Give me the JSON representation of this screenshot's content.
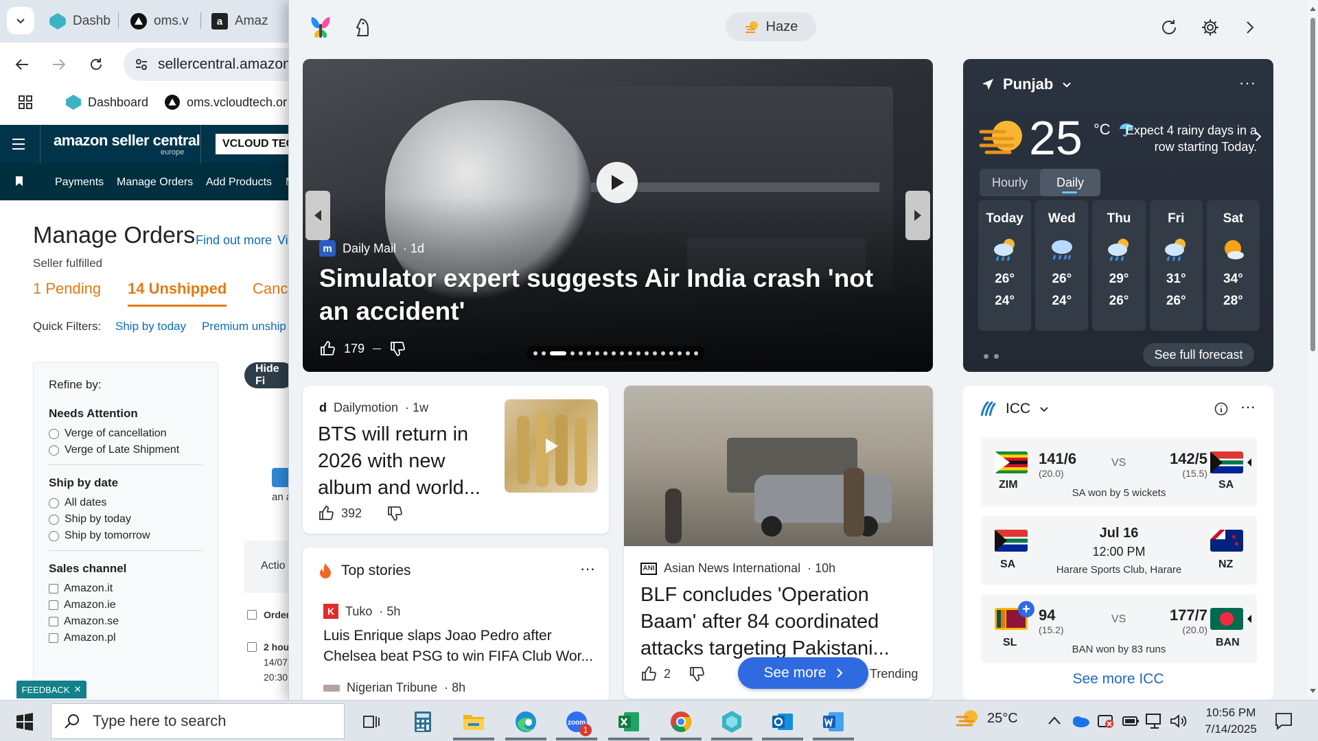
{
  "browser": {
    "tabs": [
      {
        "label": "Dashb",
        "color": "#3bb3c3"
      },
      {
        "label": "oms.v",
        "color": "#111111"
      },
      {
        "label": "Amaz",
        "color": "#222222"
      }
    ],
    "address": "sellercentral.amazon",
    "bookmarks": [
      "Dashboard",
      "oms.vcloudtech.or"
    ],
    "amazon": {
      "logo": "amazon seller central",
      "logo_sub": "europe",
      "store_btn": "VCLOUD TEC",
      "nav": [
        "Payments",
        "Manage Orders",
        "Add Products",
        "M"
      ]
    },
    "orders": {
      "title": "Manage Orders",
      "find_out_more": "Find out more",
      "vi": "Vi",
      "seller_fulfilled": "Seller fulfilled",
      "tab_pending": "1 Pending",
      "tab_unshipped_count": "14",
      "tab_unshipped": "Unshipped",
      "tab_cancelled": "Cance",
      "quick_filters": "Quick Filters:",
      "qf_today": "Ship by today",
      "qf_premium": "Premium unship",
      "hide_filters": "Hide Fi",
      "refine_title": "Refine by:",
      "needs_attention": "Needs Attention",
      "na_options": [
        "Verge of cancellation",
        "Verge of Late Shipment"
      ],
      "ship_by_date": "Ship by date",
      "sbd_options": [
        "All dates",
        "Ship by today",
        "Ship by tomorrow"
      ],
      "sales_channel": "Sales channel",
      "sc_options": [
        "Amazon.it",
        "Amazon.ie",
        "Amazon.se",
        "Amazon.pl"
      ],
      "an_a": "an a",
      "actio": "Actio",
      "order_col": "Order",
      "row_hours": "2 hou",
      "row_date": "14/07",
      "row_time": "20:30",
      "feedback": "FEEDBACK"
    }
  },
  "widgets": {
    "weather_pill": "Haze",
    "hero": {
      "source": "Daily Mail",
      "age": "· 1d",
      "title": "Simulator expert suggests Air India crash 'not an accident'",
      "likes": "179"
    },
    "weather": {
      "location": "Punjab",
      "temp": "25",
      "unit": "°C",
      "forecast": "Expect 4 rainy days in a row starting Today.",
      "tab_hourly": "Hourly",
      "tab_daily": "Daily",
      "days": [
        {
          "name": "Today",
          "hi": "26°",
          "lo": "24°",
          "icon": "rain-cloud-icon"
        },
        {
          "name": "Wed",
          "hi": "26°",
          "lo": "24°",
          "icon": "storm-cloud-icon"
        },
        {
          "name": "Thu",
          "hi": "29°",
          "lo": "26°",
          "icon": "rain-cloud-icon"
        },
        {
          "name": "Fri",
          "hi": "31°",
          "lo": "26°",
          "icon": "rain-cloud-icon"
        },
        {
          "name": "Sat",
          "hi": "34°",
          "lo": "28°",
          "icon": "partly-sunny-icon"
        }
      ],
      "see_full": "See full forecast"
    },
    "bts": {
      "source": "Dailymotion",
      "age": "· 1w",
      "title": "BTS will return in 2026 with new album and world...",
      "likes": "392"
    },
    "top_stories": {
      "title": "Top stories",
      "items": [
        {
          "source": "Tuko",
          "age": "· 5h",
          "title": "Luis Enrique slaps Joao Pedro after Chelsea beat PSG to win FIFA Club Wor..."
        },
        {
          "source": "Nigerian Tribune",
          "age": "· 8h"
        }
      ]
    },
    "blf": {
      "source": "Asian News International",
      "age": "· 10h",
      "title": "BLF concludes 'Operation Baam' after 84 coordinated attacks targeting Pakistani...",
      "likes": "2",
      "see_more": "See more",
      "trending": "Trending"
    },
    "icc": {
      "title": "ICC",
      "matches": [
        {
          "t1": "ZIM",
          "s1": "141/6",
          "o1": "(20.0)",
          "t2": "SA",
          "s2": "142/5",
          "o2": "(15.5)",
          "vs": "VS",
          "result": "SA won by 5 wickets"
        },
        {
          "t1": "SA",
          "t2": "NZ",
          "date": "Jul 16",
          "time": "12:00 PM",
          "venue": "Harare Sports Club, Harare"
        },
        {
          "t1": "SL",
          "s1": "94",
          "o1": "(15.2)",
          "t2": "BAN",
          "s2": "177/7",
          "o2": "(20.0)",
          "vs": "VS",
          "result": "BAN won by 83 runs"
        }
      ],
      "see_more": "See more ICC"
    }
  },
  "taskbar": {
    "search_placeholder": "Type here to search",
    "weather_temp": "25°C",
    "time": "10:56 PM",
    "date": "7/14/2025",
    "teams_badge": "1"
  },
  "colors": {
    "amazon_header": "#00344a",
    "accent_blue": "#2f6ae0",
    "link_blue": "#0b6bbd",
    "orange": "#e47911"
  }
}
